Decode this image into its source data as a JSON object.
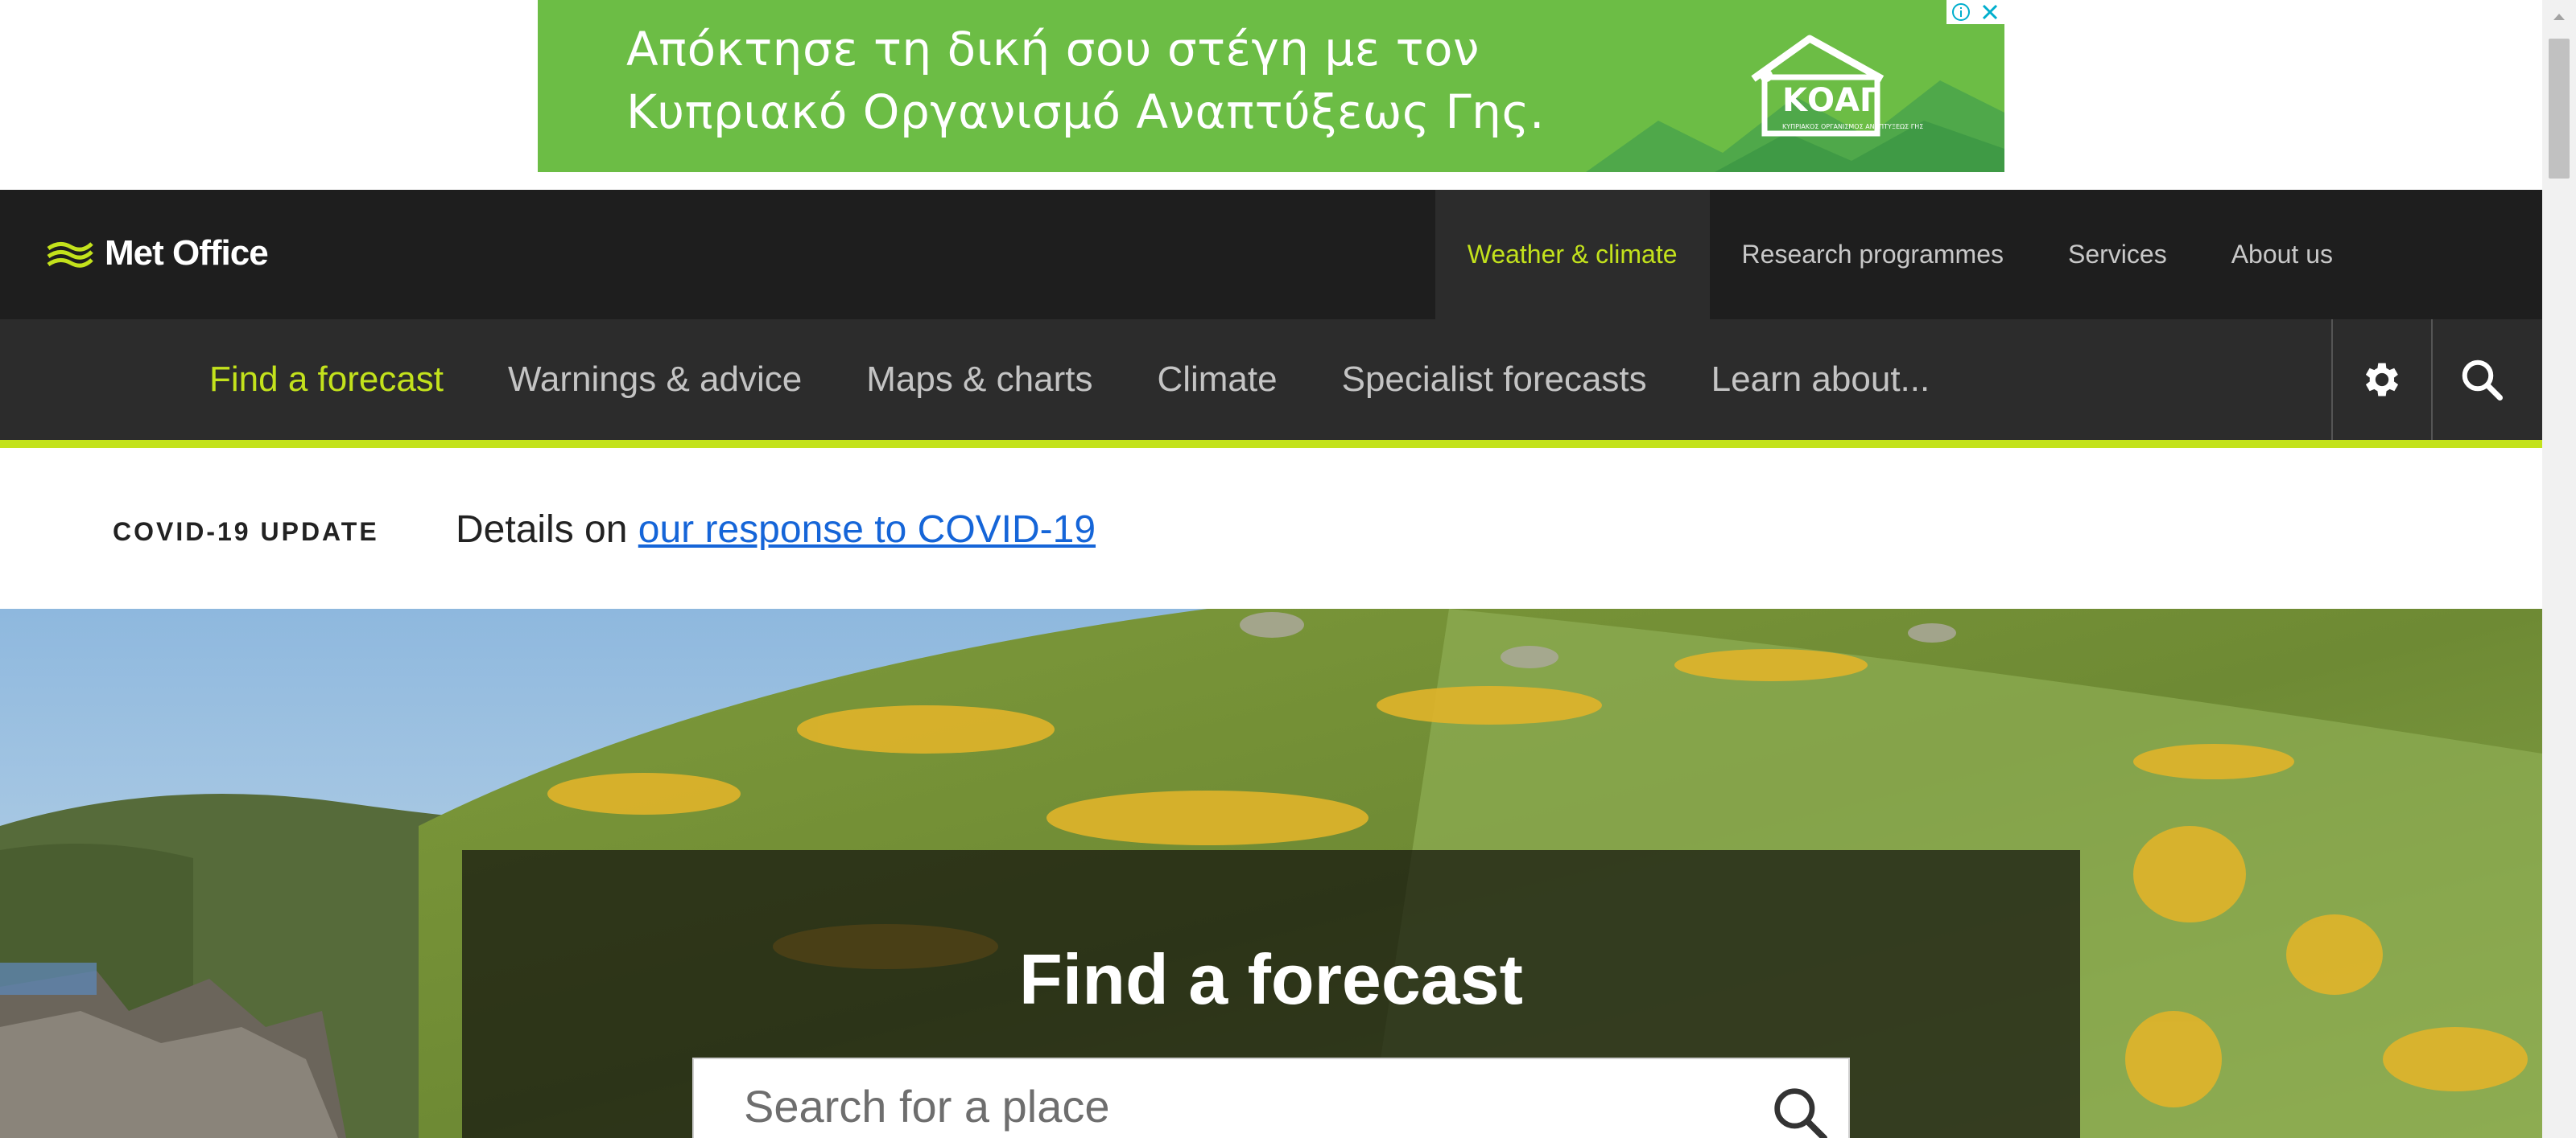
{
  "ad": {
    "line1": "Απόκτησε τη δική σου στέγη με τον",
    "line2": "Κυπριακό Οργανισμό Αναπτύξεως Γης.",
    "logo_text": "ΚΟΑΓ",
    "logo_subtext": "ΚΥΠΡΙΑΚΟΣ ΟΡΓΑΝΙΣΜΟΣ ΑΝΑΠΤΥΞΕΩΣ ΓΗΣ",
    "background_color": "#6cbd45",
    "info_icon": "info-icon",
    "close_icon": "close-icon"
  },
  "header": {
    "logo_text": "Met Office",
    "top_nav": [
      {
        "label": "Weather & climate",
        "active": true
      },
      {
        "label": "Research programmes",
        "active": false
      },
      {
        "label": "Services",
        "active": false
      },
      {
        "label": "About us",
        "active": false
      }
    ],
    "sub_nav": [
      {
        "label": "Find a forecast",
        "active": true
      },
      {
        "label": "Warnings & advice",
        "active": false
      },
      {
        "label": "Maps & charts",
        "active": false
      },
      {
        "label": "Climate",
        "active": false
      },
      {
        "label": "Specialist forecasts",
        "active": false
      },
      {
        "label": "Learn about...",
        "active": false
      }
    ],
    "settings_icon": "gear-icon",
    "search_icon": "search-icon",
    "accent_color": "#c3e21c",
    "dark_color": "#1e1e1e"
  },
  "covid": {
    "label": "COVID-19 UPDATE",
    "text_prefix": "Details on ",
    "link_text": "our response to COVID-19",
    "link_color": "#1565d8"
  },
  "hero": {
    "title": "Find a forecast",
    "search_placeholder": "Search for a place",
    "search_value": "",
    "search_button_icon": "search-icon"
  }
}
